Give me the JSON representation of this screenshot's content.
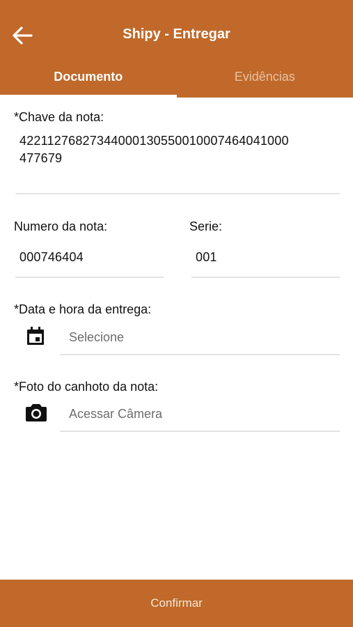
{
  "header": {
    "title": "Shipy - Entregar",
    "back_icon": "arrow-left-icon",
    "color": "#c0692a"
  },
  "tabs": [
    {
      "label": "Documento",
      "active": true
    },
    {
      "label": "Evidências",
      "active": false
    }
  ],
  "form": {
    "chave": {
      "label": "*Chave da nota:",
      "value_line1": "42211276827344000130550010007464041000",
      "value_line2": "477679"
    },
    "numero": {
      "label": "Numero da nota:",
      "value": "000746404"
    },
    "serie": {
      "label": "Serie:",
      "value": "001"
    },
    "data_hora": {
      "label": "*Data e hora da entrega:",
      "placeholder": "Selecione",
      "icon": "calendar-icon"
    },
    "foto": {
      "label": "*Foto do canhoto da nota:",
      "placeholder": "Acessar Câmera",
      "icon": "camera-icon"
    }
  },
  "footer": {
    "confirm_label": "Confirmar"
  }
}
